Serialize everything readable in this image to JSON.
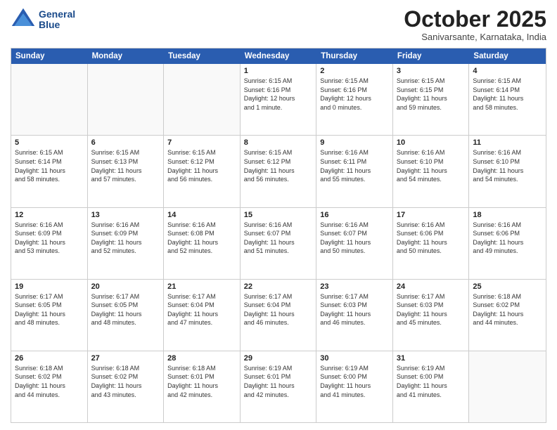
{
  "header": {
    "logo_line1": "General",
    "logo_line2": "Blue",
    "month": "October 2025",
    "location": "Sanivarsante, Karnataka, India"
  },
  "day_headers": [
    "Sunday",
    "Monday",
    "Tuesday",
    "Wednesday",
    "Thursday",
    "Friday",
    "Saturday"
  ],
  "weeks": [
    [
      {
        "num": "",
        "info": ""
      },
      {
        "num": "",
        "info": ""
      },
      {
        "num": "",
        "info": ""
      },
      {
        "num": "1",
        "info": "Sunrise: 6:15 AM\nSunset: 6:16 PM\nDaylight: 12 hours\nand 1 minute."
      },
      {
        "num": "2",
        "info": "Sunrise: 6:15 AM\nSunset: 6:16 PM\nDaylight: 12 hours\nand 0 minutes."
      },
      {
        "num": "3",
        "info": "Sunrise: 6:15 AM\nSunset: 6:15 PM\nDaylight: 11 hours\nand 59 minutes."
      },
      {
        "num": "4",
        "info": "Sunrise: 6:15 AM\nSunset: 6:14 PM\nDaylight: 11 hours\nand 58 minutes."
      }
    ],
    [
      {
        "num": "5",
        "info": "Sunrise: 6:15 AM\nSunset: 6:14 PM\nDaylight: 11 hours\nand 58 minutes."
      },
      {
        "num": "6",
        "info": "Sunrise: 6:15 AM\nSunset: 6:13 PM\nDaylight: 11 hours\nand 57 minutes."
      },
      {
        "num": "7",
        "info": "Sunrise: 6:15 AM\nSunset: 6:12 PM\nDaylight: 11 hours\nand 56 minutes."
      },
      {
        "num": "8",
        "info": "Sunrise: 6:15 AM\nSunset: 6:12 PM\nDaylight: 11 hours\nand 56 minutes."
      },
      {
        "num": "9",
        "info": "Sunrise: 6:16 AM\nSunset: 6:11 PM\nDaylight: 11 hours\nand 55 minutes."
      },
      {
        "num": "10",
        "info": "Sunrise: 6:16 AM\nSunset: 6:10 PM\nDaylight: 11 hours\nand 54 minutes."
      },
      {
        "num": "11",
        "info": "Sunrise: 6:16 AM\nSunset: 6:10 PM\nDaylight: 11 hours\nand 54 minutes."
      }
    ],
    [
      {
        "num": "12",
        "info": "Sunrise: 6:16 AM\nSunset: 6:09 PM\nDaylight: 11 hours\nand 53 minutes."
      },
      {
        "num": "13",
        "info": "Sunrise: 6:16 AM\nSunset: 6:09 PM\nDaylight: 11 hours\nand 52 minutes."
      },
      {
        "num": "14",
        "info": "Sunrise: 6:16 AM\nSunset: 6:08 PM\nDaylight: 11 hours\nand 52 minutes."
      },
      {
        "num": "15",
        "info": "Sunrise: 6:16 AM\nSunset: 6:07 PM\nDaylight: 11 hours\nand 51 minutes."
      },
      {
        "num": "16",
        "info": "Sunrise: 6:16 AM\nSunset: 6:07 PM\nDaylight: 11 hours\nand 50 minutes."
      },
      {
        "num": "17",
        "info": "Sunrise: 6:16 AM\nSunset: 6:06 PM\nDaylight: 11 hours\nand 50 minutes."
      },
      {
        "num": "18",
        "info": "Sunrise: 6:16 AM\nSunset: 6:06 PM\nDaylight: 11 hours\nand 49 minutes."
      }
    ],
    [
      {
        "num": "19",
        "info": "Sunrise: 6:17 AM\nSunset: 6:05 PM\nDaylight: 11 hours\nand 48 minutes."
      },
      {
        "num": "20",
        "info": "Sunrise: 6:17 AM\nSunset: 6:05 PM\nDaylight: 11 hours\nand 48 minutes."
      },
      {
        "num": "21",
        "info": "Sunrise: 6:17 AM\nSunset: 6:04 PM\nDaylight: 11 hours\nand 47 minutes."
      },
      {
        "num": "22",
        "info": "Sunrise: 6:17 AM\nSunset: 6:04 PM\nDaylight: 11 hours\nand 46 minutes."
      },
      {
        "num": "23",
        "info": "Sunrise: 6:17 AM\nSunset: 6:03 PM\nDaylight: 11 hours\nand 46 minutes."
      },
      {
        "num": "24",
        "info": "Sunrise: 6:17 AM\nSunset: 6:03 PM\nDaylight: 11 hours\nand 45 minutes."
      },
      {
        "num": "25",
        "info": "Sunrise: 6:18 AM\nSunset: 6:02 PM\nDaylight: 11 hours\nand 44 minutes."
      }
    ],
    [
      {
        "num": "26",
        "info": "Sunrise: 6:18 AM\nSunset: 6:02 PM\nDaylight: 11 hours\nand 44 minutes."
      },
      {
        "num": "27",
        "info": "Sunrise: 6:18 AM\nSunset: 6:02 PM\nDaylight: 11 hours\nand 43 minutes."
      },
      {
        "num": "28",
        "info": "Sunrise: 6:18 AM\nSunset: 6:01 PM\nDaylight: 11 hours\nand 42 minutes."
      },
      {
        "num": "29",
        "info": "Sunrise: 6:19 AM\nSunset: 6:01 PM\nDaylight: 11 hours\nand 42 minutes."
      },
      {
        "num": "30",
        "info": "Sunrise: 6:19 AM\nSunset: 6:00 PM\nDaylight: 11 hours\nand 41 minutes."
      },
      {
        "num": "31",
        "info": "Sunrise: 6:19 AM\nSunset: 6:00 PM\nDaylight: 11 hours\nand 41 minutes."
      },
      {
        "num": "",
        "info": ""
      }
    ]
  ]
}
